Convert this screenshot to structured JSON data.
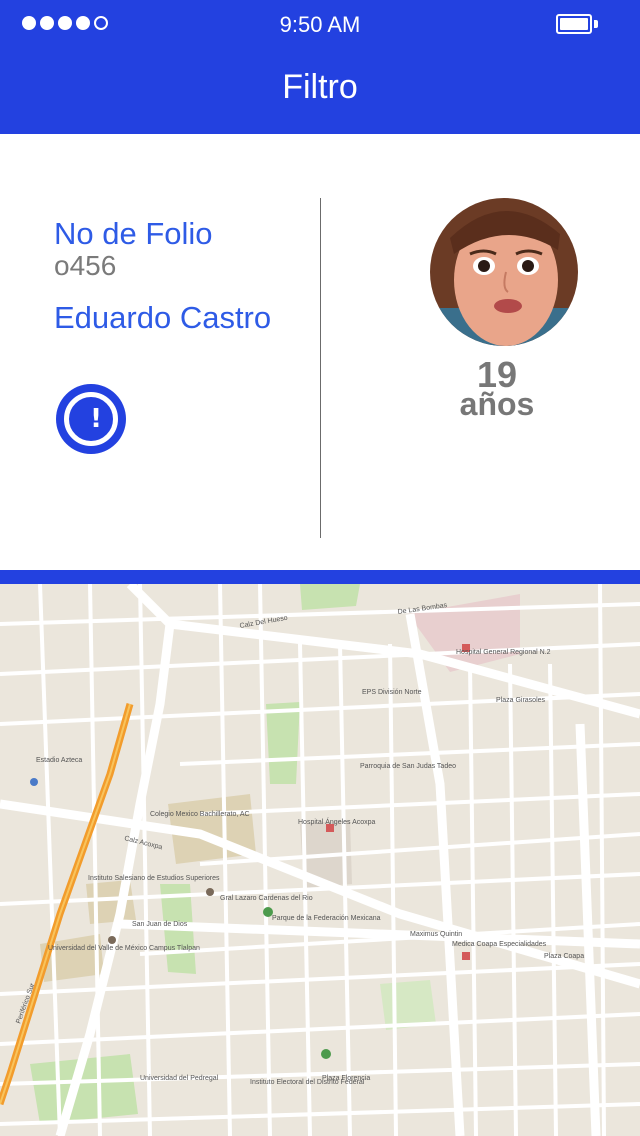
{
  "status_bar": {
    "time": "9:50 AM",
    "signal_bars_filled": 4,
    "signal_bars_total": 5,
    "battery_level": 1.0
  },
  "nav": {
    "title": "Filtro"
  },
  "record": {
    "folio_label": "No de Folio",
    "folio_value": "o456",
    "name": "Eduardo Castro",
    "age_number": "19",
    "age_unit": "años",
    "alert_icon": "alert-circle-icon"
  },
  "colors": {
    "primary": "#2341e0",
    "link": "#2e5be6",
    "muted": "#7a7a7a"
  },
  "map": {
    "labels": [
      "De Las Bombas",
      "Calz Del Hueso",
      "Hospital General Regional N.2",
      "Plaza Girasoles",
      "Estadio Azteca",
      "Colegio Mexico Bachillerato, AC",
      "Hospital Ángeles Acoxpa",
      "Calz Acoxpa",
      "Instituto Salesiano de Estudios Superiores",
      "Gral Lazaro Cardenas del Rio",
      "Parque de la Federación Mexicana",
      "San Juan de Dios",
      "Universidad del Valle de México Campus Tlalpan",
      "Medica Coapa Especialidades",
      "Maximus Quintin",
      "Universidad del Pedregal",
      "Instituto Electoral del Distrito Federal",
      "Plaza Florencia",
      "Parroquia de San Judas Tadeo",
      "Plaza Coapa",
      "EPS División Norte",
      "Periférico Sur"
    ]
  }
}
